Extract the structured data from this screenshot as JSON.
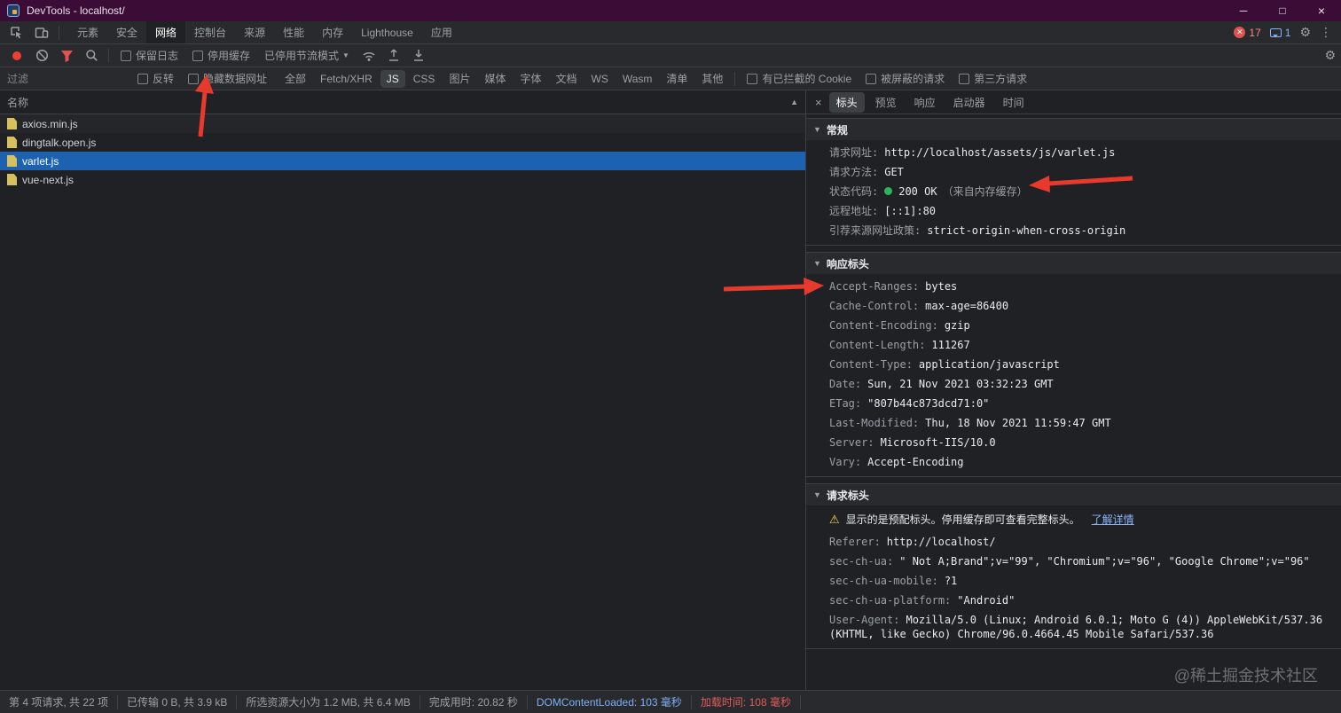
{
  "window": {
    "title": "DevTools - localhost/"
  },
  "main_tabs": {
    "items": [
      "元素",
      "安全",
      "网络",
      "控制台",
      "来源",
      "性能",
      "内存",
      "Lighthouse",
      "应用"
    ],
    "selected": "网络",
    "error_count": "17",
    "issue_count": "1"
  },
  "network_toolbar": {
    "preserve_log_label": "保留日志",
    "disable_cache_label": "停用缓存",
    "throttling_label": "已停用节流模式"
  },
  "filter_bar": {
    "placeholder": "过滤",
    "invert_label": "反转",
    "hide_data_urls_label": "隐藏数据网址",
    "chips": [
      "全部",
      "Fetch/XHR",
      "JS",
      "CSS",
      "图片",
      "媒体",
      "字体",
      "文档",
      "WS",
      "Wasm",
      "清单",
      "其他"
    ],
    "selected_chip": "JS",
    "blocked_cookies_label": "有已拦截的 Cookie",
    "blocked_requests_label": "被屏蔽的请求",
    "third_party_label": "第三方请求"
  },
  "request_list": {
    "header": "名称",
    "rows": [
      {
        "name": "axios.min.js"
      },
      {
        "name": "dingtalk.open.js"
      },
      {
        "name": "varlet.js"
      },
      {
        "name": "vue-next.js"
      }
    ],
    "selected": "varlet.js"
  },
  "detail_tabs": {
    "items": [
      "标头",
      "预览",
      "响应",
      "启动器",
      "时间"
    ],
    "selected": "标头"
  },
  "headers_panel": {
    "general": {
      "title": "常规",
      "rows": [
        {
          "name": "请求网址:",
          "value": "http://localhost/assets/js/varlet.js"
        },
        {
          "name": "请求方法:",
          "value": "GET"
        },
        {
          "name": "状态代码:",
          "value": "200 OK",
          "note": "（来自内存缓存）"
        },
        {
          "name": "远程地址:",
          "value": "[::1]:80"
        },
        {
          "name": "引荐来源网址政策:",
          "value": "strict-origin-when-cross-origin"
        }
      ]
    },
    "response_headers": {
      "title": "响应标头",
      "rows": [
        {
          "name": "Accept-Ranges:",
          "value": "bytes"
        },
        {
          "name": "Cache-Control:",
          "value": "max-age=86400"
        },
        {
          "name": "Content-Encoding:",
          "value": "gzip"
        },
        {
          "name": "Content-Length:",
          "value": "111267"
        },
        {
          "name": "Content-Type:",
          "value": "application/javascript"
        },
        {
          "name": "Date:",
          "value": "Sun, 21 Nov 2021 03:32:23 GMT"
        },
        {
          "name": "ETag:",
          "value": "\"807b44c873dcd71:0\""
        },
        {
          "name": "Last-Modified:",
          "value": "Thu, 18 Nov 2021 11:59:47 GMT"
        },
        {
          "name": "Server:",
          "value": "Microsoft-IIS/10.0"
        },
        {
          "name": "Vary:",
          "value": "Accept-Encoding"
        }
      ]
    },
    "request_headers": {
      "title": "请求标头",
      "warning": "显示的是预配标头。停用缓存即可查看完整标头。",
      "learn_more": "了解详情",
      "rows": [
        {
          "name": "Referer:",
          "value": "http://localhost/"
        },
        {
          "name": "sec-ch-ua:",
          "value": "\" Not A;Brand\";v=\"99\", \"Chromium\";v=\"96\", \"Google Chrome\";v=\"96\""
        },
        {
          "name": "sec-ch-ua-mobile:",
          "value": "?1"
        },
        {
          "name": "sec-ch-ua-platform:",
          "value": "\"Android\""
        },
        {
          "name": "User-Agent:",
          "value": "Mozilla/5.0 (Linux; Android 6.0.1; Moto G (4)) AppleWebKit/537.36 (KHTML, like Gecko) Chrome/96.0.4664.45 Mobile Safari/537.36"
        }
      ]
    }
  },
  "status_bar": {
    "requests": "第 4 项请求, 共 22 项",
    "transferred": "已传输 0 B, 共 3.9 kB",
    "resources": "所选资源大小为 1.2 MB, 共 6.4 MB",
    "finish": "完成用时: 20.82 秒",
    "dom_content_loaded": "DOMContentLoaded: 103 毫秒",
    "load": "加载时间: 108 毫秒"
  },
  "watermark": "@稀土掘金技术社区",
  "colors": {
    "titlebar_purple": "#3a0c36",
    "selection_blue": "#1d62b0",
    "accent_blue": "#8ab4f8",
    "error_red": "#f28b82",
    "status_green": "#2db35c",
    "arrow_red": "#e8392d",
    "warning_yellow": "#fdd663",
    "load_time_red": "#e05c5c"
  }
}
